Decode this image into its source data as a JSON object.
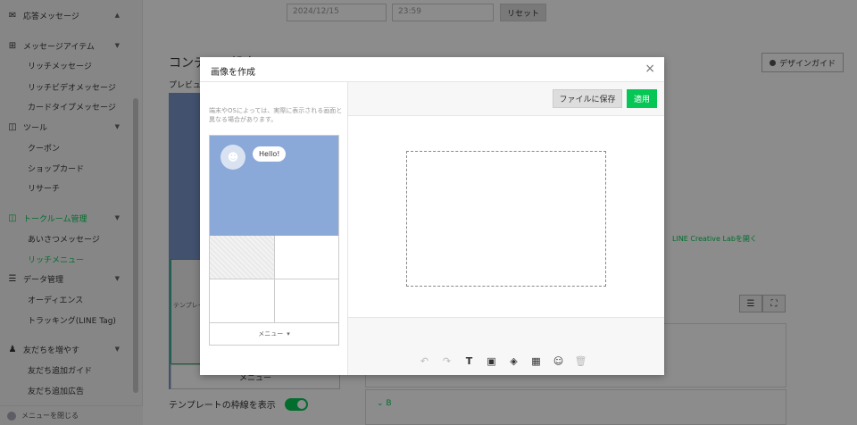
{
  "sidebar": {
    "items": [
      {
        "label": "応答メッセージ",
        "type": "head",
        "icon": "chat-bubble-icon"
      },
      {
        "label": "メッセージアイテム",
        "type": "head",
        "icon": "plus-box-icon"
      },
      {
        "label": "リッチメッセージ",
        "type": "sub"
      },
      {
        "label": "リッチビデオメッセージ",
        "type": "sub"
      },
      {
        "label": "カードタイプメッセージ",
        "type": "sub"
      },
      {
        "label": "ツール",
        "type": "head",
        "icon": "toolbox-icon"
      },
      {
        "label": "クーポン",
        "type": "sub"
      },
      {
        "label": "ショップカード",
        "type": "sub"
      },
      {
        "label": "リサーチ",
        "type": "sub"
      },
      {
        "label": "トークルーム管理",
        "type": "head",
        "icon": "room-icon",
        "active": true
      },
      {
        "label": "あいさつメッセージ",
        "type": "sub"
      },
      {
        "label": "リッチメニュー",
        "type": "sub",
        "active": true
      },
      {
        "label": "データ管理",
        "type": "head",
        "icon": "database-icon"
      },
      {
        "label": "オーディエンス",
        "type": "sub"
      },
      {
        "label": "トラッキング(LINE Tag)",
        "type": "sub"
      },
      {
        "label": "友だちを増やす",
        "type": "head",
        "icon": "add-friend-icon"
      },
      {
        "label": "友だち追加ガイド",
        "type": "sub"
      },
      {
        "label": "友だち追加広告",
        "type": "sub"
      }
    ],
    "footer": "メニューを閉じる"
  },
  "main": {
    "date_value": "2024/12/15",
    "time_value": "23:59",
    "reset_label": "リセット",
    "section_title": "コンテンツ設定",
    "preview_label": "プレビュー",
    "design_guide": "デザインガイド",
    "template_label": "テンプレート",
    "menu_label": "メニュー",
    "show_frame_label": "テンプレートの枠線を表示",
    "creative_link": "LINE Creative Labを開く",
    "section_b": "B"
  },
  "modal": {
    "title": "画像を作成",
    "note": "端末やOSによっては、実際に表示される画面と異なる場合があります。",
    "hello": "Hello!",
    "menu_label": "メニュー",
    "save_label": "ファイルに保存",
    "apply_label": "適用",
    "close_glyph": "×"
  },
  "colors": {
    "accent": "#06c755",
    "preview_blue": "#8aa8d8"
  }
}
